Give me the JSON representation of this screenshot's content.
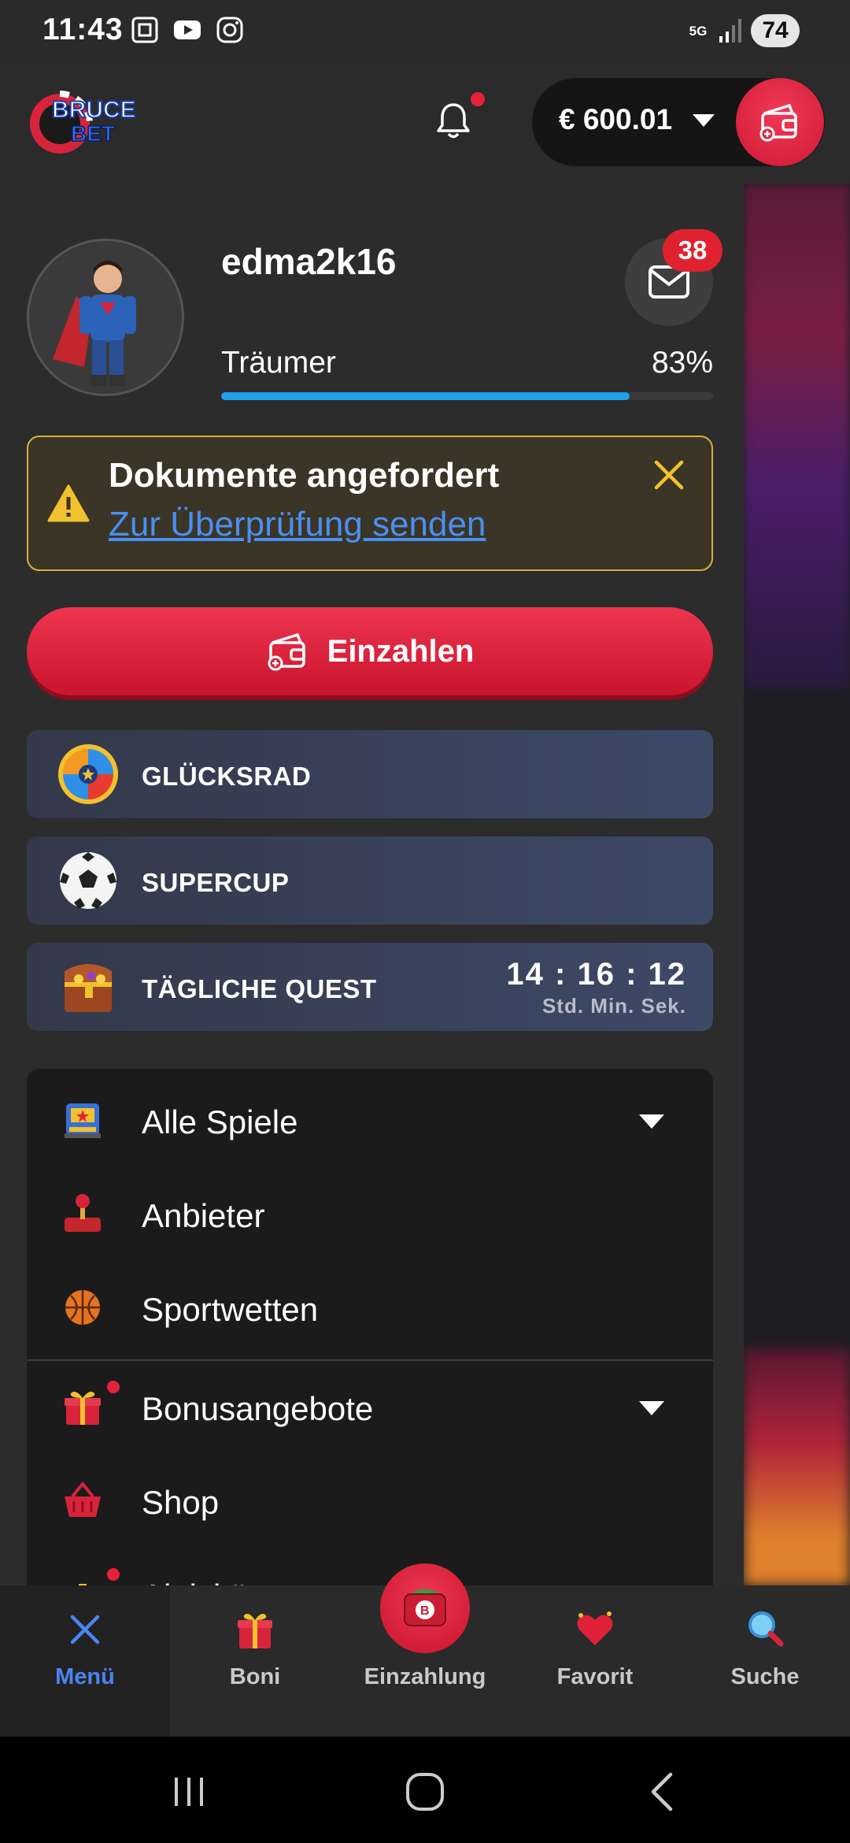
{
  "status_bar": {
    "time": "11:43",
    "network": "5G",
    "battery": "74",
    "icons": [
      "screenshot-icon",
      "youtube-icon",
      "instagram-icon",
      "signal-icon"
    ]
  },
  "header": {
    "logo_text_1": "BRUCE",
    "logo_text_2": "BET",
    "balance": "€ 600.01",
    "notification_dot": true
  },
  "profile": {
    "username": "edma2k16",
    "messages_count": "38",
    "level_name": "Träumer",
    "level_percent_label": "83%",
    "level_progress": 0.83
  },
  "alert": {
    "title": "Dokumente angefordert",
    "link": "Zur Überprüfung senden"
  },
  "deposit_button": {
    "label": "Einzahlen"
  },
  "promos": [
    {
      "label": "GLÜCKSRAD",
      "icon": "wheel-icon"
    },
    {
      "label": "SUPERCUP",
      "icon": "soccer-ball-icon"
    },
    {
      "label": "TÄGLICHE QUEST",
      "icon": "treasure-chest-icon",
      "timer": "14 : 16 : 12",
      "timer_units": "Std. Min. Sek."
    }
  ],
  "menu": {
    "items": [
      {
        "label": "Alle Spiele",
        "icon": "slot-machine-icon",
        "expandable": true
      },
      {
        "label": "Anbieter",
        "icon": "joystick-icon"
      },
      {
        "label": "Sportwetten",
        "icon": "basketball-icon"
      },
      {
        "label": "Bonusangebote",
        "icon": "gift-icon",
        "expandable": true,
        "dot": true
      },
      {
        "label": "Shop",
        "icon": "basket-icon"
      },
      {
        "label": "Aktivität",
        "icon": "activity-icon",
        "dot": true
      }
    ]
  },
  "bottom_nav": {
    "items": [
      {
        "label": "Menü",
        "icon": "close-icon",
        "active": true
      },
      {
        "label": "Boni",
        "icon": "gift-icon"
      },
      {
        "label": "Einzahlung",
        "icon": "wallet-icon"
      },
      {
        "label": "Favorit",
        "icon": "heart-icon"
      },
      {
        "label": "Suche",
        "icon": "search-icon"
      }
    ]
  },
  "colors": {
    "accent_red": "#e0213a",
    "link_blue": "#4a8ff2",
    "progress_blue": "#1ea0ea",
    "alert_border": "#d9b13a"
  }
}
